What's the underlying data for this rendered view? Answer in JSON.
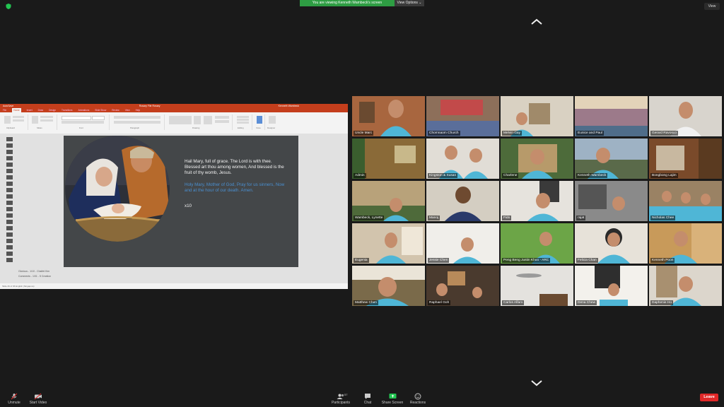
{
  "meeting": {
    "banner": "You are viewing Kenneth Wambeck's screen",
    "view_options": "View Options ⌄",
    "view_button": "View"
  },
  "ppt": {
    "title_bar": "AutoSave",
    "file_name": "Rosary File Rosary",
    "user": "Kenneth Wambeck",
    "tabs": [
      "File",
      "Home",
      "Insert",
      "Draw",
      "Design",
      "Transitions",
      "Animations",
      "Slide Show",
      "Review",
      "View",
      "Help"
    ],
    "ribbon_groups": [
      "Clipboard",
      "Slides",
      "Font",
      "Paragraph",
      "Drawing",
      "Editing",
      "Voice",
      "Designer"
    ],
    "slide": {
      "prayer_1": "Hail Mary, full of grace. The Lord is with thee. Blessed art thou among women, And blessed is the fruit of thy womb, Jesus.",
      "prayer_2": "Holy Mary, Mother of God, Pray for us sinners, Now and at the hour of our death. Amen.",
      "repeat": "x10"
    },
    "notes": [
      "Glorious - 1/10 - Chaifet Kim",
      "Comments - 1/01 - 5 Creation"
    ],
    "status": "Slide 26 of 36   English (Singapore)"
  },
  "participants": [
    "Uncle Marc",
    "Chomnaom Church",
    "Melvin Gay",
    "Eunice and Paul",
    "Gerard Ravosco",
    "Admin",
    "Kingston & Susan",
    "Charlene",
    "Kenneth Wambeck",
    "Bongbong Lajim",
    "Wambeck, Lynette",
    "Manoj",
    "Fido",
    "rajat",
    "Nicholas Chee",
    "Eugenia",
    "Jessie Chen",
    "Peng Beng Justin Khoo - ARC",
    "Felicia Chan",
    "Kenneth Poon",
    "Matthew Chen",
    "Raphael Goh",
    "Carlos Alfaro",
    "Dena Chew",
    "Daphenie Ho"
  ],
  "toolbar": {
    "unmute": "Unmute",
    "start_video": "Start Video",
    "participants": "Participants",
    "participants_count": "57",
    "chat": "Chat",
    "share_screen": "Share Screen",
    "reactions": "Reactions",
    "leave": "Leave"
  },
  "colors": {
    "banner_green": "#2e9d43",
    "ppt_red": "#c43e1c",
    "leave_red": "#e02828",
    "share_green": "#23c552"
  }
}
